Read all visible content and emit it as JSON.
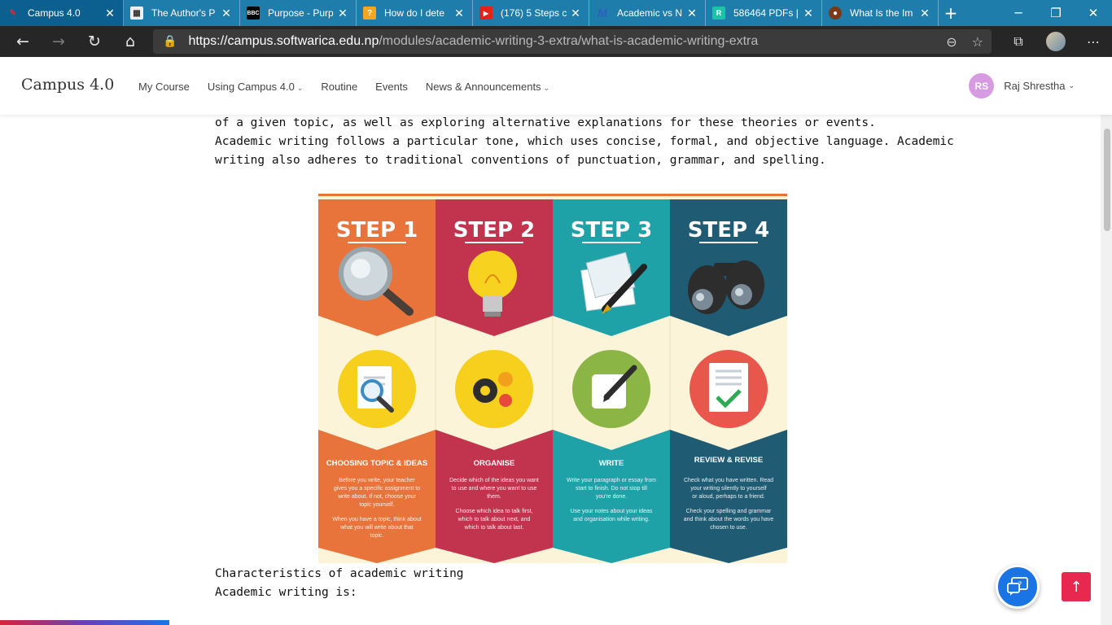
{
  "browser": {
    "tabs": [
      {
        "title": "Campus 4.0",
        "active": true,
        "icon": "campus-icon"
      },
      {
        "title": "The Author's P",
        "active": false,
        "icon": "authors-icon"
      },
      {
        "title": "Purpose - Purp",
        "active": false,
        "icon": "bbc-icon"
      },
      {
        "title": "How do I dete",
        "active": false,
        "icon": "question-icon"
      },
      {
        "title": "(176) 5 Steps c",
        "active": false,
        "icon": "youtube-icon"
      },
      {
        "title": "Academic vs N",
        "active": false,
        "icon": "m-logo-icon"
      },
      {
        "title": "586464 PDFs |",
        "active": false,
        "icon": "researchgate-icon"
      },
      {
        "title": "What Is the Im",
        "active": false,
        "icon": "globe-icon"
      }
    ],
    "url_host": "https://campus.softwarica.edu.np",
    "url_path": "/modules/academic-writing-3-extra/what-is-academic-writing-extra"
  },
  "site": {
    "logo_text": "Campus 4.0",
    "menu": [
      "My Course",
      "Using Campus 4.0",
      "Routine",
      "Events",
      "News & Announcements"
    ],
    "user_initials": "RS",
    "user_name": "Raj Shrestha"
  },
  "content": {
    "line1": "of a given topic, as well as exploring alternative explanations for these theories or events.",
    "line2": "Academic writing follows a particular tone, which uses concise, formal, and objective language. Academic",
    "line3": "writing also adheres to traditional conventions of punctuation, grammar, and spelling.",
    "heading": "Characteristics of academic writing",
    "subline": "Academic writing is:"
  },
  "infographic": {
    "steps": [
      {
        "label": "STEP 1",
        "title": "CHOOSING TOPIC & IDEAS",
        "body": "Before you write, your teacher gives you a specific assignment to write about. If not, choose your topic yourself.",
        "body2": "When you have a topic, think about what you will write about that topic.",
        "color": "#e8743b"
      },
      {
        "label": "STEP 2",
        "title": "ORGANISE",
        "body": "Decide which of the ideas you want to use and where you want to use them.",
        "body2": "Choose which idea to talk first, which to talk about next, and which to talk about last.",
        "color": "#c2334d"
      },
      {
        "label": "STEP 3",
        "title": "WRITE",
        "body": "Write your paragraph or essay from start to finish. Do not stop till you're done.",
        "body2": "Use your notes about your ideas and organisation while writing.",
        "color": "#1fa1a8"
      },
      {
        "label": "STEP 4",
        "title": "REVIEW & REVISE",
        "body": "Check what you have written. Read your writing silently to yourself or aloud, perhaps to a friend.",
        "body2": "Check your spelling and grammar and think about the words you have chosen to use.",
        "color": "#1f5b73"
      }
    ]
  }
}
